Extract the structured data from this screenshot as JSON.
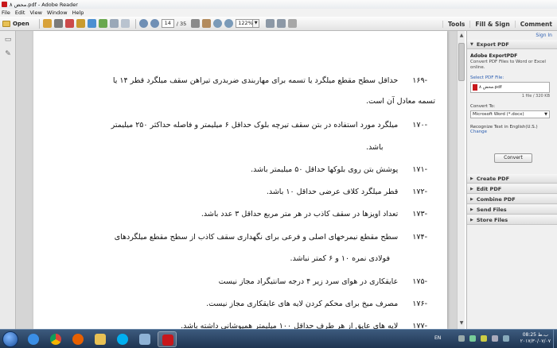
{
  "window": {
    "title": "محض ۸.pdf - Adobe Reader"
  },
  "menu": [
    "File",
    "Edit",
    "View",
    "Window",
    "Help"
  ],
  "toolbar": {
    "open_label": "Open",
    "page_current": "14",
    "page_total": "/ 35",
    "zoom": "122%",
    "right_links": [
      "Tools",
      "Fill & Sign",
      "Comment"
    ]
  },
  "document": {
    "paragraphs": [
      {
        "num": "-۱۶۹",
        "text": "حداقل سطح مقطع میلگرد یا تسمه برای مهاربندی ضربدری تیراهن سقف میلگرد قطر ۱۴ یا",
        "cont": "تسمه معادل آن است."
      },
      {
        "num": "-۱۷۰",
        "text": "میلگرد مورد استفاده در بتن سقف تیرچه بلوک حداقل ۶ میلیمتر و فاصله حداکثر ۲۵۰ میلیمتر",
        "cont": "باشد."
      },
      {
        "num": "-۱۷۱",
        "text": "پوشش بتن روی بلوکها حداقل ۵۰ میلیمتر باشد.",
        "cont": ""
      },
      {
        "num": "-۱۷۲",
        "text": "قطر میلگرد کلاف عرضی حداقل ۱۰ باشد.",
        "cont": ""
      },
      {
        "num": "-۱۷۳",
        "text": "تعداد اویزها در سقف کاذب در هر متر مربع حداقل ۳ عدد باشد.",
        "cont": ""
      },
      {
        "num": "-۱۷۴",
        "text": "سطح مقطع نیمرخهای اصلی و فرعی برای نگهداری سقف کاذب از سطح مقطع میلگردهای",
        "cont": "فولادی نمره ۱۰ و ۶ کمتر نباشد."
      },
      {
        "num": "-۱۷۵",
        "text": "عایقکاری در هوای سرد زیر ۴ درجه سانتیگراد مجاز نیست",
        "cont": ""
      },
      {
        "num": "-۱۷۶",
        "text": "مصرف میخ برای محکم کردن لایه های عایقکاری مجاز نیست.",
        "cont": ""
      },
      {
        "num": "-۱۷۷",
        "text": "لایه های عایق از هر طرف حداقل ۱۰۰ میلیمتر همپوشانی داشته باشد.",
        "cont": ""
      }
    ]
  },
  "right_panel": {
    "sign_in": "Sign In",
    "export_header": "Export PDF",
    "export_title": "Adobe ExportPDF",
    "export_desc": "Convert PDF Files to Word or Excel online.",
    "select_label": "Select PDF File:",
    "file_name": "محض ۸.pdf",
    "file_size": "1 file / 320 KB",
    "convert_to_label": "Convert To:",
    "convert_to_value": "Microsoft Word (*.docx)",
    "recognize": "Recognize Text in English(U.S.)",
    "change": "Change",
    "convert_button": "Convert",
    "sections": [
      "Create PDF",
      "Edit PDF",
      "Combine PDF",
      "Send Files",
      "Store Files"
    ]
  },
  "taskbar": {
    "lang": "EN",
    "time": "08:25 ب.ظ",
    "date": "۲۰۱۷/۳۰/۰۷/۰۷"
  },
  "colors": {
    "accent_red": "#c8171b",
    "link_blue": "#2a5db0",
    "taskbar": "#2a4466"
  }
}
